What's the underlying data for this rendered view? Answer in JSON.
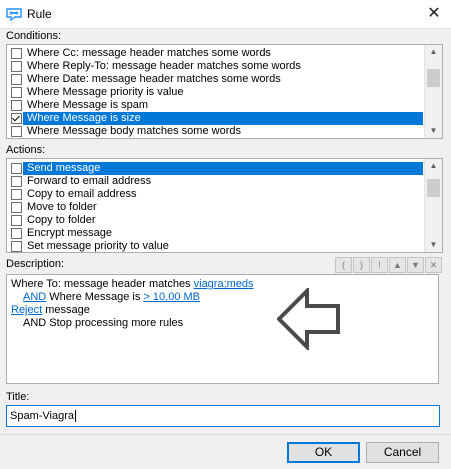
{
  "window": {
    "title": "Rule",
    "close_glyph": "✕",
    "icon": "rule-app-icon"
  },
  "conditions": {
    "label": "Conditions:",
    "items": [
      {
        "label": "Where Cc: message header matches some words",
        "checked": false,
        "selected": false
      },
      {
        "label": "Where Reply-To: message header matches some words",
        "checked": false,
        "selected": false
      },
      {
        "label": "Where Date: message header matches some words",
        "checked": false,
        "selected": false
      },
      {
        "label": "Where Message priority is value",
        "checked": false,
        "selected": false
      },
      {
        "label": "Where Message is spam",
        "checked": false,
        "selected": false
      },
      {
        "label": "Where Message is size",
        "checked": true,
        "selected": true
      },
      {
        "label": "Where Message body matches some words",
        "checked": false,
        "selected": false
      }
    ]
  },
  "actions": {
    "label": "Actions:",
    "items": [
      {
        "label": "Send message",
        "checked": false,
        "selected": true
      },
      {
        "label": "Forward to email address",
        "checked": false,
        "selected": false
      },
      {
        "label": "Copy to email address",
        "checked": false,
        "selected": false
      },
      {
        "label": "Move to folder",
        "checked": false,
        "selected": false
      },
      {
        "label": "Copy to folder",
        "checked": false,
        "selected": false
      },
      {
        "label": "Encrypt message",
        "checked": false,
        "selected": false
      },
      {
        "label": "Set message priority to value",
        "checked": false,
        "selected": false
      }
    ]
  },
  "description": {
    "label": "Description:",
    "toolbar": [
      "(",
      ")",
      "!",
      "▲",
      "▼",
      "✕"
    ],
    "line1_prefix": "Where To: message header matches ",
    "line1_link": "viagra;meds",
    "line2_link_and": "AND",
    "line2_middle": " Where Message is ",
    "line2_link_size": "> 10,00 MB",
    "line3_link": "Reject",
    "line3_suffix": " message",
    "line4": "AND Stop processing more rules",
    "overlay_icon": "left-arrow-icon"
  },
  "title_field": {
    "label": "Title:",
    "value": "Spam-Viagra"
  },
  "buttons": {
    "ok": "OK",
    "cancel": "Cancel"
  },
  "colors": {
    "selection": "#0078d7",
    "link": "#0066cc",
    "focus_border": "#0078d7"
  }
}
